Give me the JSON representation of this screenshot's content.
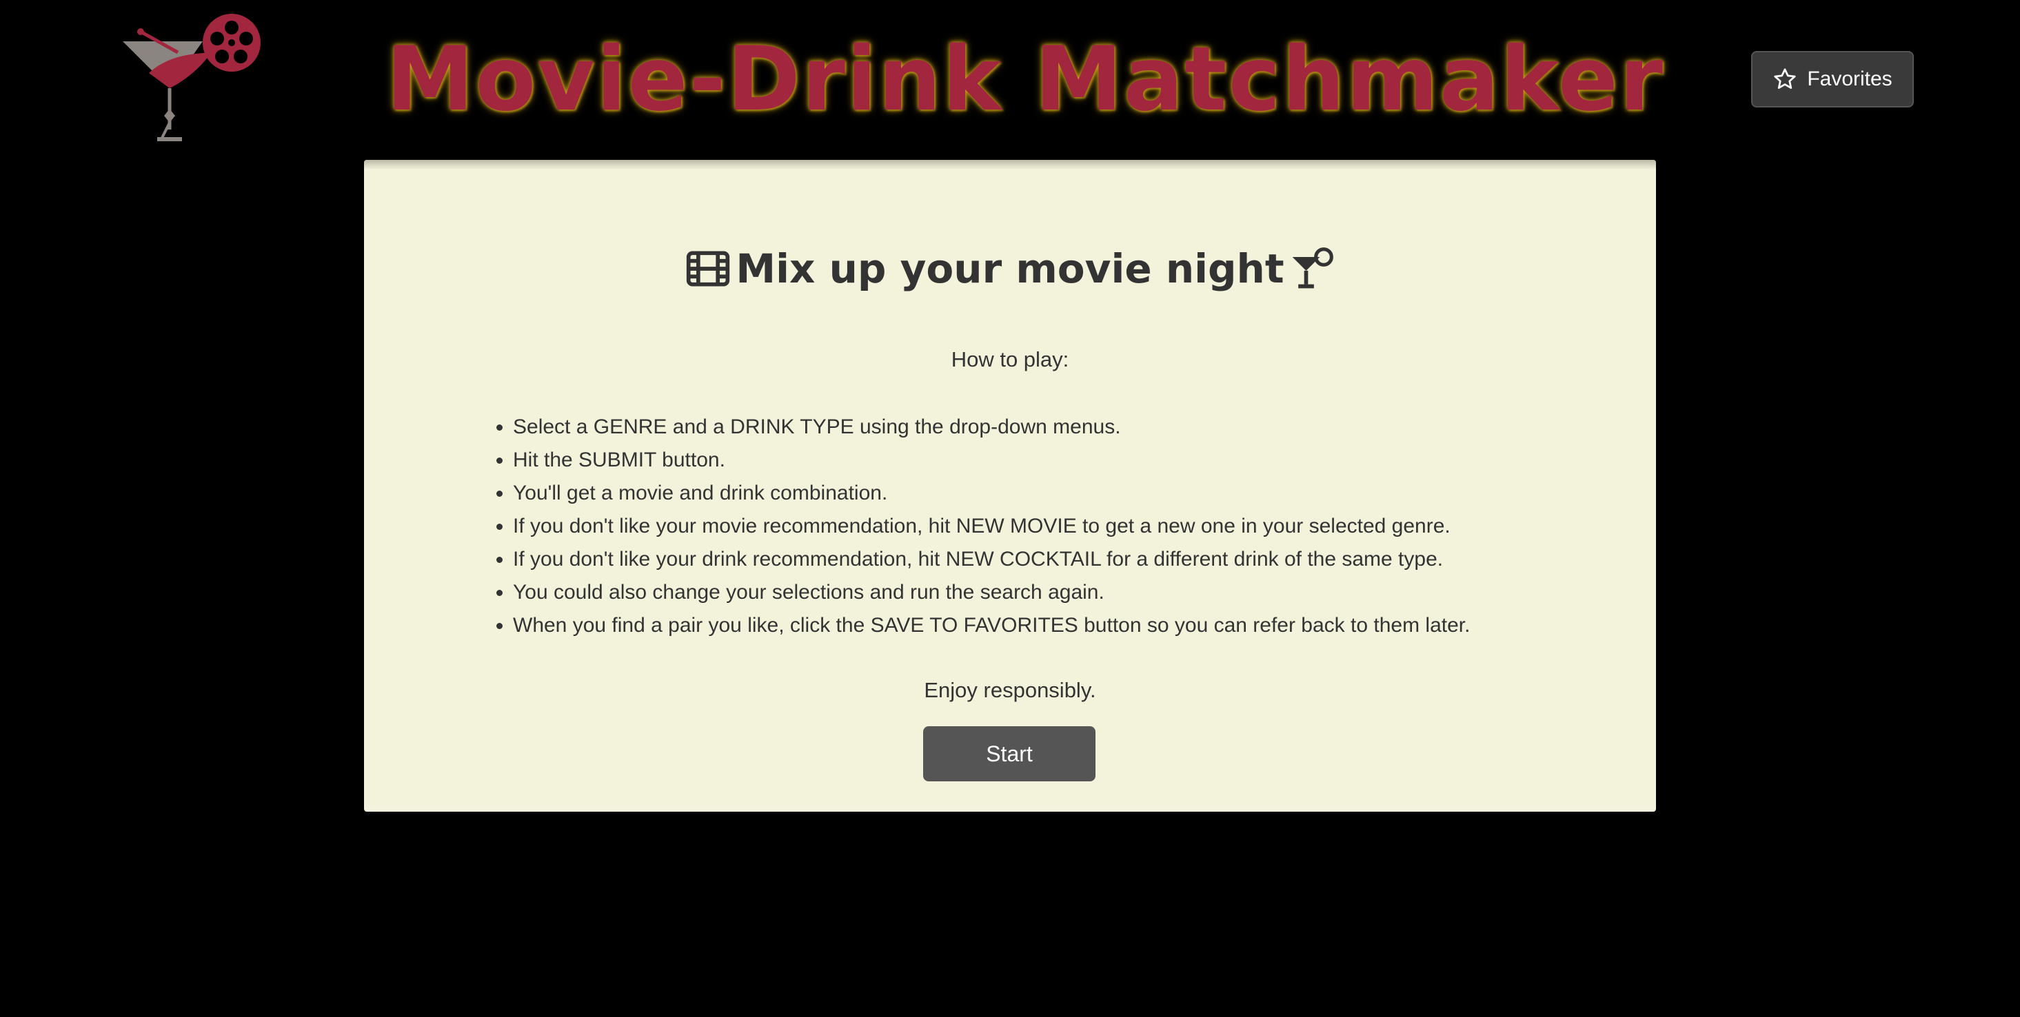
{
  "header": {
    "title": "Movie-Drink Matchmaker",
    "logo_icon": "cocktail-film-reel-logo",
    "favorites_label": "Favorites",
    "favorites_icon": "star-outline-icon"
  },
  "intro": {
    "heading": "Mix up your movie night",
    "heading_left_icon": "film-strip-icon",
    "heading_right_icon": "cocktail-glass-icon",
    "how_to_label": "How to play:",
    "rules": [
      "Select a GENRE and a DRINK TYPE using the drop-down menus.",
      "Hit the SUBMIT button.",
      "You'll get a movie and drink combination.",
      "If you don't like your movie recommendation, hit NEW MOVIE to get a new one in your selected genre.",
      "If you don't like your drink recommendation, hit NEW COCKTAIL for a different drink of the same type.",
      "You could also change your selections and run the search again.",
      "When you find a pair you like, click the SAVE TO FAVORITES button so you can refer back to them later."
    ],
    "closing": "Enjoy responsibly.",
    "start_label": "Start"
  },
  "colors": {
    "background": "#000000",
    "title": "#a3263f",
    "title_glow": "#c9a31a",
    "card": "#f3f3dc",
    "text": "#333333",
    "button": "#555555"
  }
}
